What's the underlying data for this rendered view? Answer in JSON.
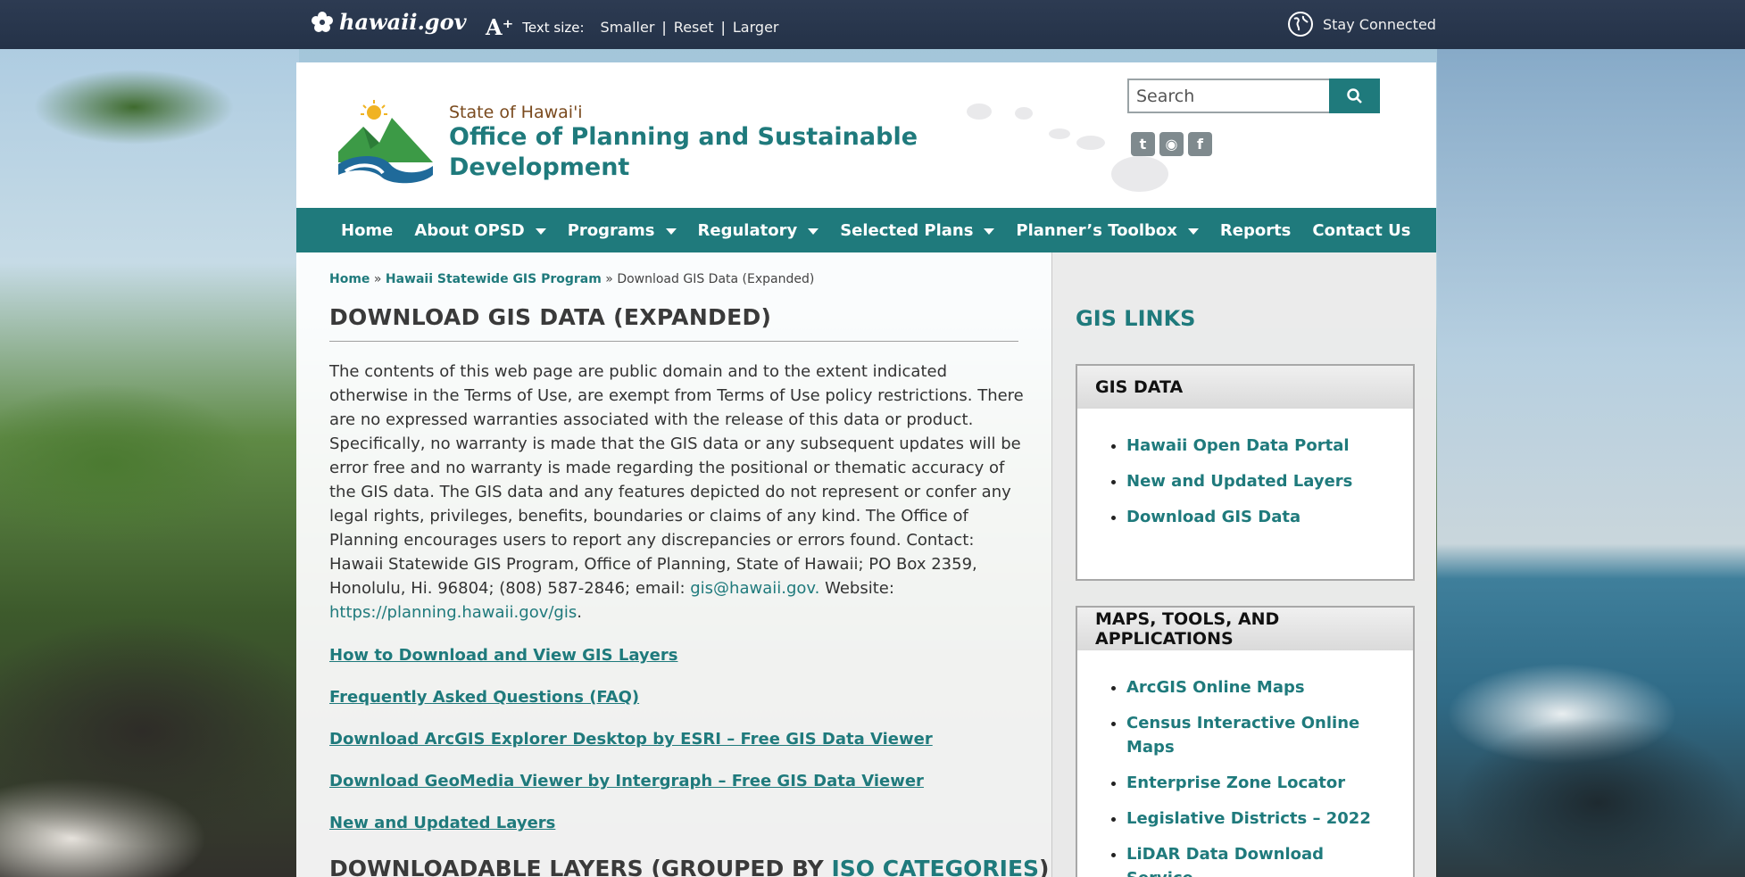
{
  "topbar": {
    "brand": "hawaii.gov",
    "text_size_label": "Text size:",
    "smaller": "Smaller",
    "reset": "Reset",
    "larger": "Larger",
    "separator": "|",
    "stay_connected": "Stay Connected"
  },
  "header": {
    "state": "State of Hawai'i",
    "title": "Office of Planning and Sustainable Development",
    "search_placeholder": "Search",
    "social": [
      "twitter-icon",
      "rss-icon",
      "facebook-icon"
    ]
  },
  "nav": {
    "items": [
      {
        "label": "Home",
        "dropdown": false
      },
      {
        "label": "About OPSD",
        "dropdown": true
      },
      {
        "label": "Programs",
        "dropdown": true
      },
      {
        "label": "Regulatory",
        "dropdown": true
      },
      {
        "label": "Selected Plans",
        "dropdown": true
      },
      {
        "label": "Planner’s Toolbox",
        "dropdown": true
      },
      {
        "label": "Reports",
        "dropdown": false
      },
      {
        "label": "Contact Us",
        "dropdown": false
      }
    ]
  },
  "breadcrumb": {
    "home": "Home",
    "sep": " » ",
    "program": "Hawaii Statewide GIS Program",
    "current": "Download GIS Data (Expanded)"
  },
  "main": {
    "title": "DOWNLOAD GIS DATA (EXPANDED)",
    "body_text": "The contents of this web page are public domain and to the extent indicated otherwise in the Terms of Use, are exempt from Terms of Use policy restrictions. There are no expressed warranties associated with the release of this data or product. Specifically, no warranty is made that the GIS data or any subsequent updates will be error free and no warranty is made regarding the positional or thematic accuracy of the GIS data. The GIS data and any features depicted do not represent or confer any legal rights, privileges, benefits, boundaries or claims of any kind. The Office of Planning encourages users to report any discrepancies or errors found. Contact: Hawaii Statewide GIS Program, Office of Planning, State of Hawaii; PO Box 2359, Honolulu, Hi. 96804; (808) 587-2846; email:",
    "email_link": " gis@hawaii.gov. ",
    "website_label": "Website:",
    "website_link": "https://planning.hawaii.gov/gis",
    "period": ".",
    "links": [
      "How to Download and View GIS Layers",
      "Frequently Asked Questions (FAQ)",
      "Download ArcGIS Explorer Desktop by ESRI – Free GIS Data Viewer",
      "Download GeoMedia Viewer by Intergraph – Free GIS Data Viewer",
      "New and Updated Layers"
    ],
    "section_heading_pre": "DOWNLOADABLE LAYERS (GROUPED BY ",
    "section_heading_link": "ISO CATEGORIES",
    "section_heading_post": ")"
  },
  "sidebar": {
    "title": "GIS LINKS",
    "boxes": [
      {
        "heading": "GIS DATA",
        "items": [
          "Hawaii Open Data Portal",
          "New and Updated Layers",
          "Download GIS Data"
        ]
      },
      {
        "heading": "MAPS, TOOLS, AND APPLICATIONS",
        "items": [
          "ArcGIS Online Maps",
          "Census Interactive Online Maps",
          "Enterprise Zone Locator",
          "Legislative Districts – 2022",
          "LiDAR Data Download Service"
        ]
      }
    ]
  },
  "colors": {
    "accent": "#1f7a7c",
    "topbar": "#243248",
    "subtitle_brown": "#7a4a1e"
  }
}
